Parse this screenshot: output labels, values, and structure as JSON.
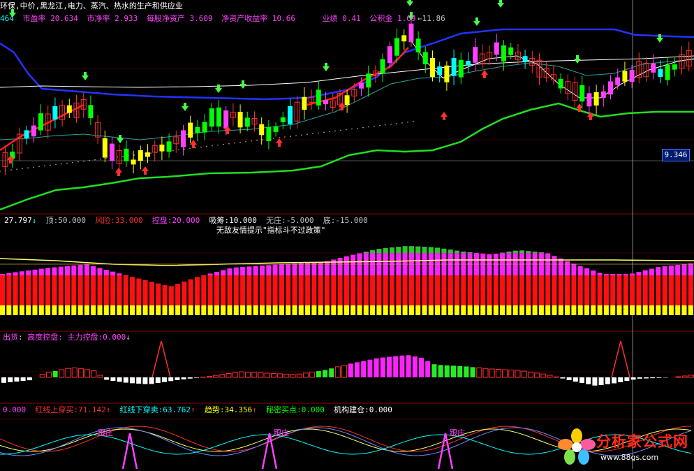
{
  "header": {
    "prefix": "464",
    "stock_info": "环保,中价,黑龙江,电力、蒸汽、热水的生产和供应业",
    "metrics": [
      {
        "label": "市盈率",
        "value": "20.634"
      },
      {
        "label": "市净率",
        "value": "2.933"
      },
      {
        "label": "每股净资产",
        "value": "3.609"
      },
      {
        "label": "净资产收益率",
        "value": "10.66"
      },
      {
        "label": "业绩",
        "value": "0.41"
      },
      {
        "label": "公积金",
        "value": "1.69"
      }
    ]
  },
  "main_panel": {
    "high_annotation": "11.86",
    "current_price": "9.346",
    "colors": {
      "rise": "#00ffff",
      "fall": "#00ff00",
      "ma_red": "#ff2020",
      "band_green": "#22dd22",
      "band_blue": "#2233ff"
    }
  },
  "panel2": {
    "prefix": "27.797",
    "items": [
      {
        "label": "顶",
        "value": "50.000",
        "color": "#c0c0c0"
      },
      {
        "label": "风险",
        "value": "33.000",
        "color": "#ff3030"
      },
      {
        "label": "控盘",
        "value": "20.000",
        "color": "#ff40ff"
      },
      {
        "label": "吸筹",
        "value": "10.000",
        "color": "#ffffff"
      },
      {
        "label": "无庄",
        "value": "-5.000",
        "color": "#c0c0c0"
      },
      {
        "label": "底",
        "value": "-15.000",
        "color": "#c0c0c0"
      }
    ],
    "notice": "无敌友情提示\"指标斗不过政策\""
  },
  "panel3": {
    "prefix": "出货",
    "items": [
      {
        "label": "高度控盘",
        "value": "",
        "color": "#ff40ff"
      },
      {
        "label": "主力控盘",
        "value": "0.000",
        "color": "#ff40ff"
      }
    ]
  },
  "panel4": {
    "prefix": "0.000",
    "items": [
      {
        "label": "红线上穿买",
        "value": "71.142",
        "color": "#ff3030"
      },
      {
        "label": "红线下穿卖",
        "value": "63.762",
        "color": "#00ffff"
      },
      {
        "label": "趋势",
        "value": "34.356",
        "color": "#ffff00"
      },
      {
        "label": "秘密买点",
        "value": "0.000",
        "color": "#00ff00"
      },
      {
        "label": "机构建仓",
        "value": "0.000",
        "color": "#ffffff"
      }
    ],
    "signal_label": "跟庄"
  },
  "logo": {
    "name": "分析家公式网",
    "url": "www.88gs.com"
  }
}
